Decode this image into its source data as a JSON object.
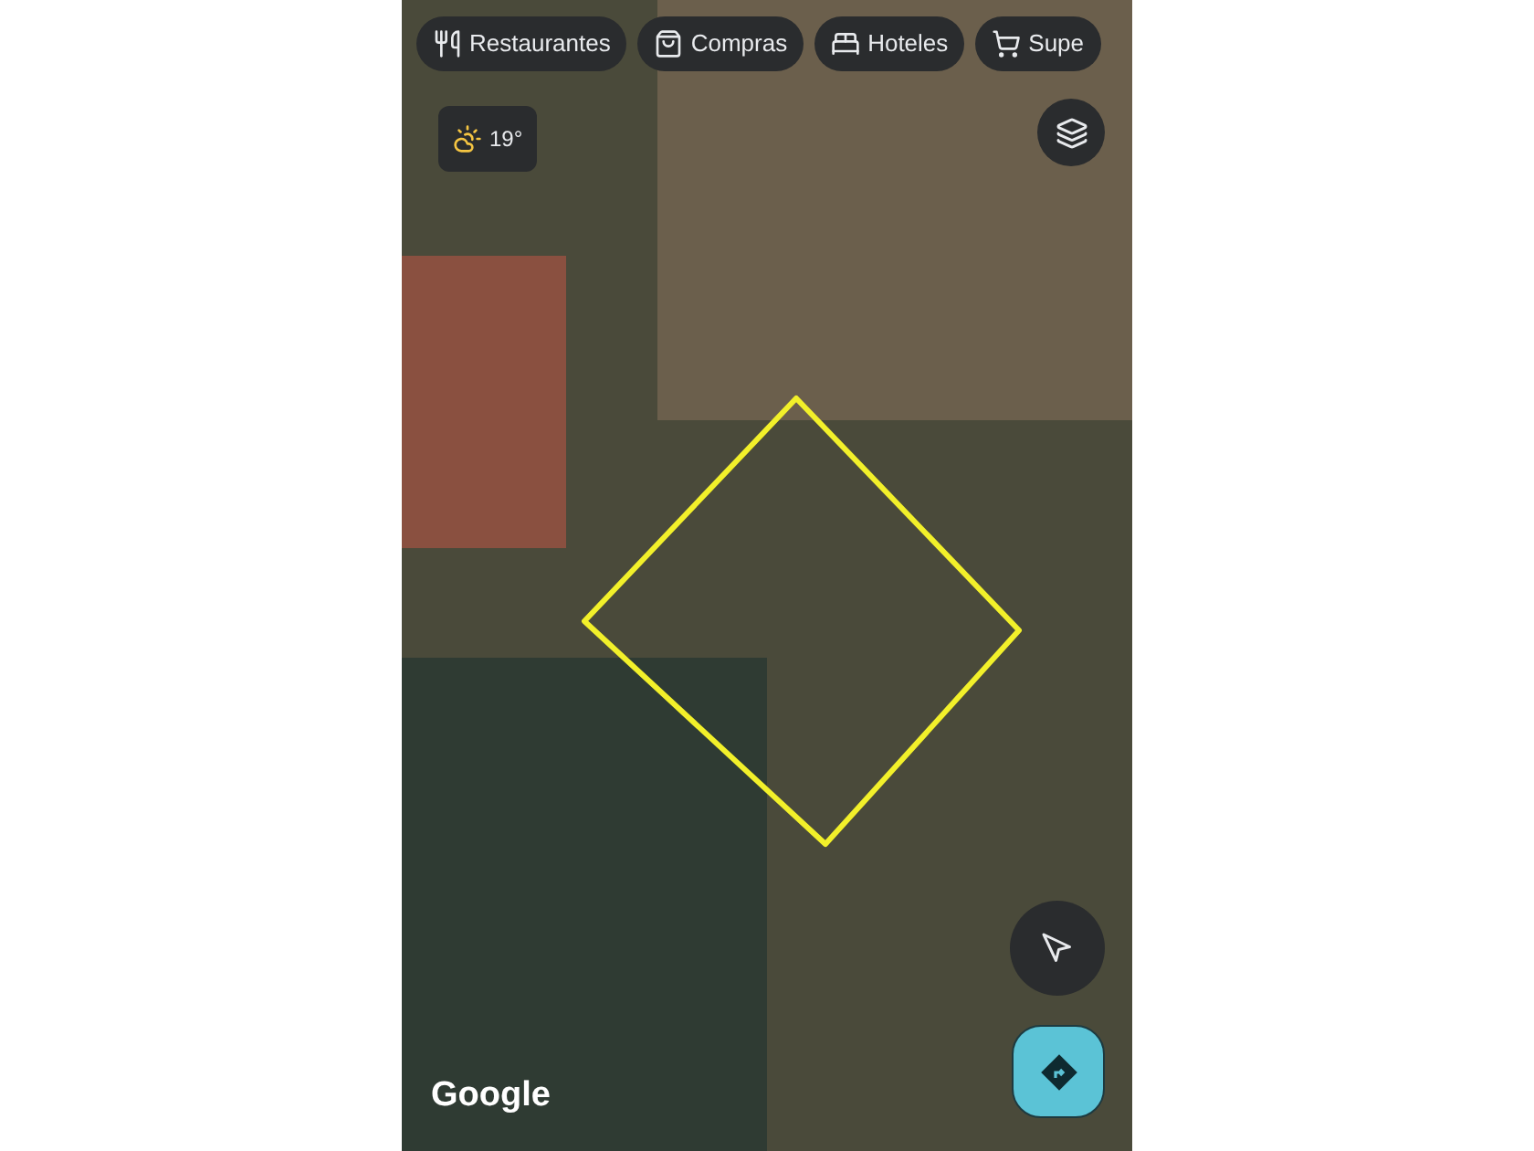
{
  "chips": [
    {
      "kind": "restaurant",
      "label": "Restaurantes"
    },
    {
      "kind": "shopping",
      "label": "Compras"
    },
    {
      "kind": "hotel",
      "label": "Hoteles"
    },
    {
      "kind": "cart",
      "label": "Supe"
    }
  ],
  "weather": {
    "temperature": "19°"
  },
  "logo": "Google"
}
